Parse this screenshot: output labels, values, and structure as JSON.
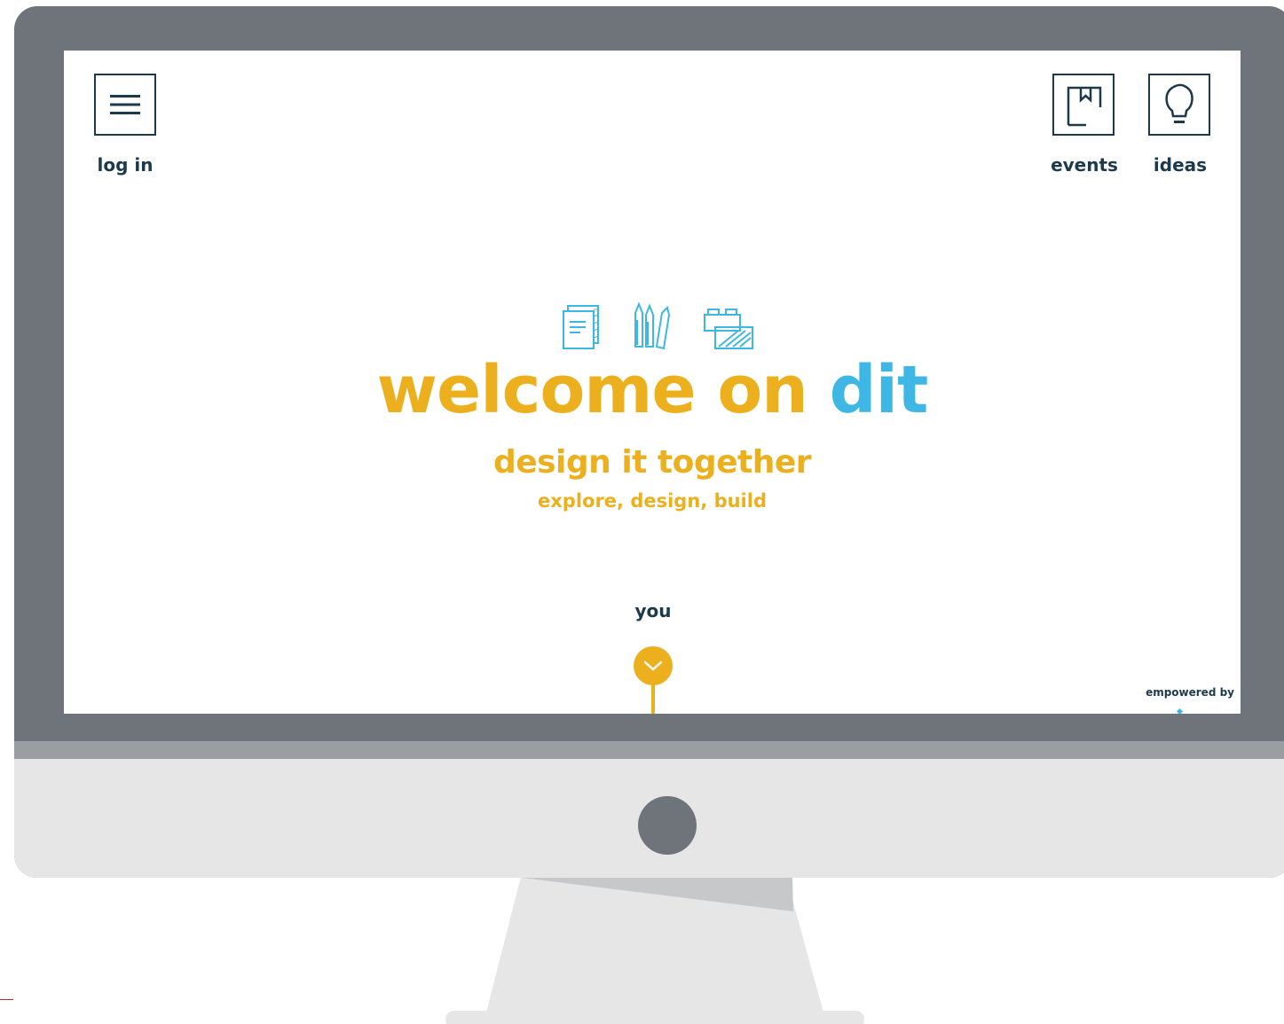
{
  "nav": {
    "login": {
      "label": "log in",
      "icon": "hamburger-menu-icon"
    },
    "events": {
      "label": "events",
      "icon": "bookmark-board-icon"
    },
    "ideas": {
      "label": "ideas",
      "icon": "lightbulb-icon"
    }
  },
  "hero": {
    "icons": [
      "notepad-icon",
      "pencils-icon",
      "building-blocks-icon"
    ],
    "title_main": "welcome on ",
    "title_brand": "dit",
    "subtitle": "design it together",
    "tagline": "explore, design, build"
  },
  "scroll": {
    "label": "you",
    "icon": "chevron-down-icon"
  },
  "footer": {
    "empowered": "empowered by"
  },
  "colors": {
    "accent_yellow": "#ecb01f",
    "brand_blue": "#3fb7e4",
    "navy_text": "#1d3a4c",
    "monitor_gray": "#6f737a",
    "monitor_chin": "#e6e6e6"
  }
}
